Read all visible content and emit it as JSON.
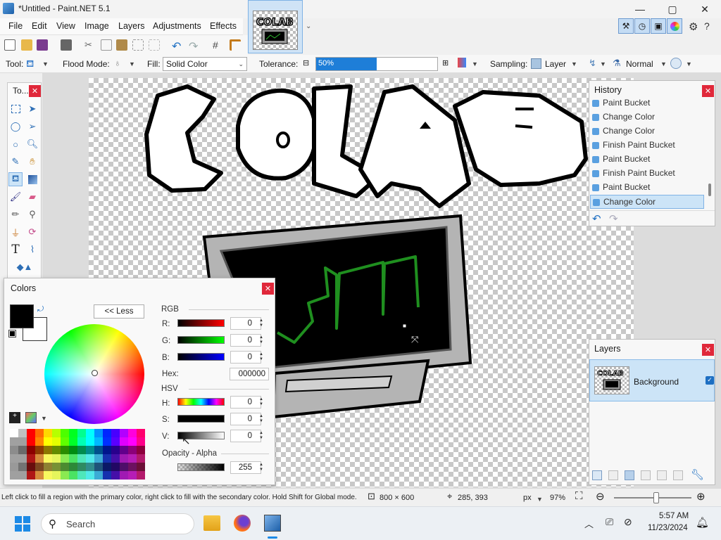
{
  "window": {
    "title": "*Untitled - Paint.NET 5.1",
    "minimize": "—",
    "maximize": "▢",
    "close": "✕"
  },
  "menu": [
    "File",
    "Edit",
    "View",
    "Image",
    "Layers",
    "Adjustments",
    "Effects"
  ],
  "toolbar": {
    "tool_label": "Tool:",
    "flood_mode_label": "Flood Mode:",
    "fill_label": "Fill:",
    "fill_value": "Solid Color",
    "tolerance_label": "Tolerance:",
    "tolerance_value": "50%",
    "tolerance_fraction": 0.5,
    "sampling_label": "Sampling:",
    "sampling_value": "Layer",
    "blend_value": "Normal"
  },
  "tools_panel": {
    "title": "To...",
    "icons": [
      "rectangle-select-icon",
      "move-selection-icon",
      "lasso-select-icon",
      "move-pixels-icon",
      "ellipse-select-icon",
      "zoom-icon",
      "magic-wand-icon",
      "pan-icon",
      "paint-bucket-icon",
      "gradient-icon",
      "paintbrush-icon",
      "eraser-icon",
      "pencil-icon",
      "color-picker-icon",
      "clone-stamp-icon",
      "recolor-icon",
      "text-icon",
      "line-curve-icon",
      "shapes-icon"
    ]
  },
  "colors_panel": {
    "title": "Colors",
    "less_button": "<< Less",
    "rgb_label": "RGB",
    "r_label": "R:",
    "g_label": "G:",
    "b_label": "B:",
    "r_value": "0",
    "g_value": "0",
    "b_value": "0",
    "hex_label": "Hex:",
    "hex_value": "000000",
    "hsv_label": "HSV",
    "h_label": "H:",
    "s_label": "S:",
    "v_label": "V:",
    "h_value": "0",
    "s_value": "0",
    "v_value": "0",
    "opacity_label": "Opacity - Alpha",
    "alpha_value": "255",
    "primary_color": "#000000",
    "secondary_color": "#ffffff"
  },
  "history_panel": {
    "title": "History",
    "items": [
      "Paint Bucket",
      "Change Color",
      "Change Color",
      "Finish Paint Bucket",
      "Paint Bucket",
      "Finish Paint Bucket",
      "Paint Bucket",
      "Change Color"
    ],
    "selected_index": 7
  },
  "layers_panel": {
    "title": "Layers",
    "layer_name": "Background"
  },
  "status": {
    "hint": "Left click to fill a region with the primary color, right click to fill with the secondary color. Hold Shift for Global mode.",
    "image_size": "800 × 600",
    "cursor_pos": "285, 393",
    "units": "px",
    "zoom": "97%"
  },
  "taskbar": {
    "search_placeholder": "Search",
    "time": "5:57 AM",
    "date": "11/23/2024"
  },
  "colors": {
    "accent": "#1e7ed8",
    "close_red": "#e0283a",
    "selection_bg": "#cce4f7"
  }
}
